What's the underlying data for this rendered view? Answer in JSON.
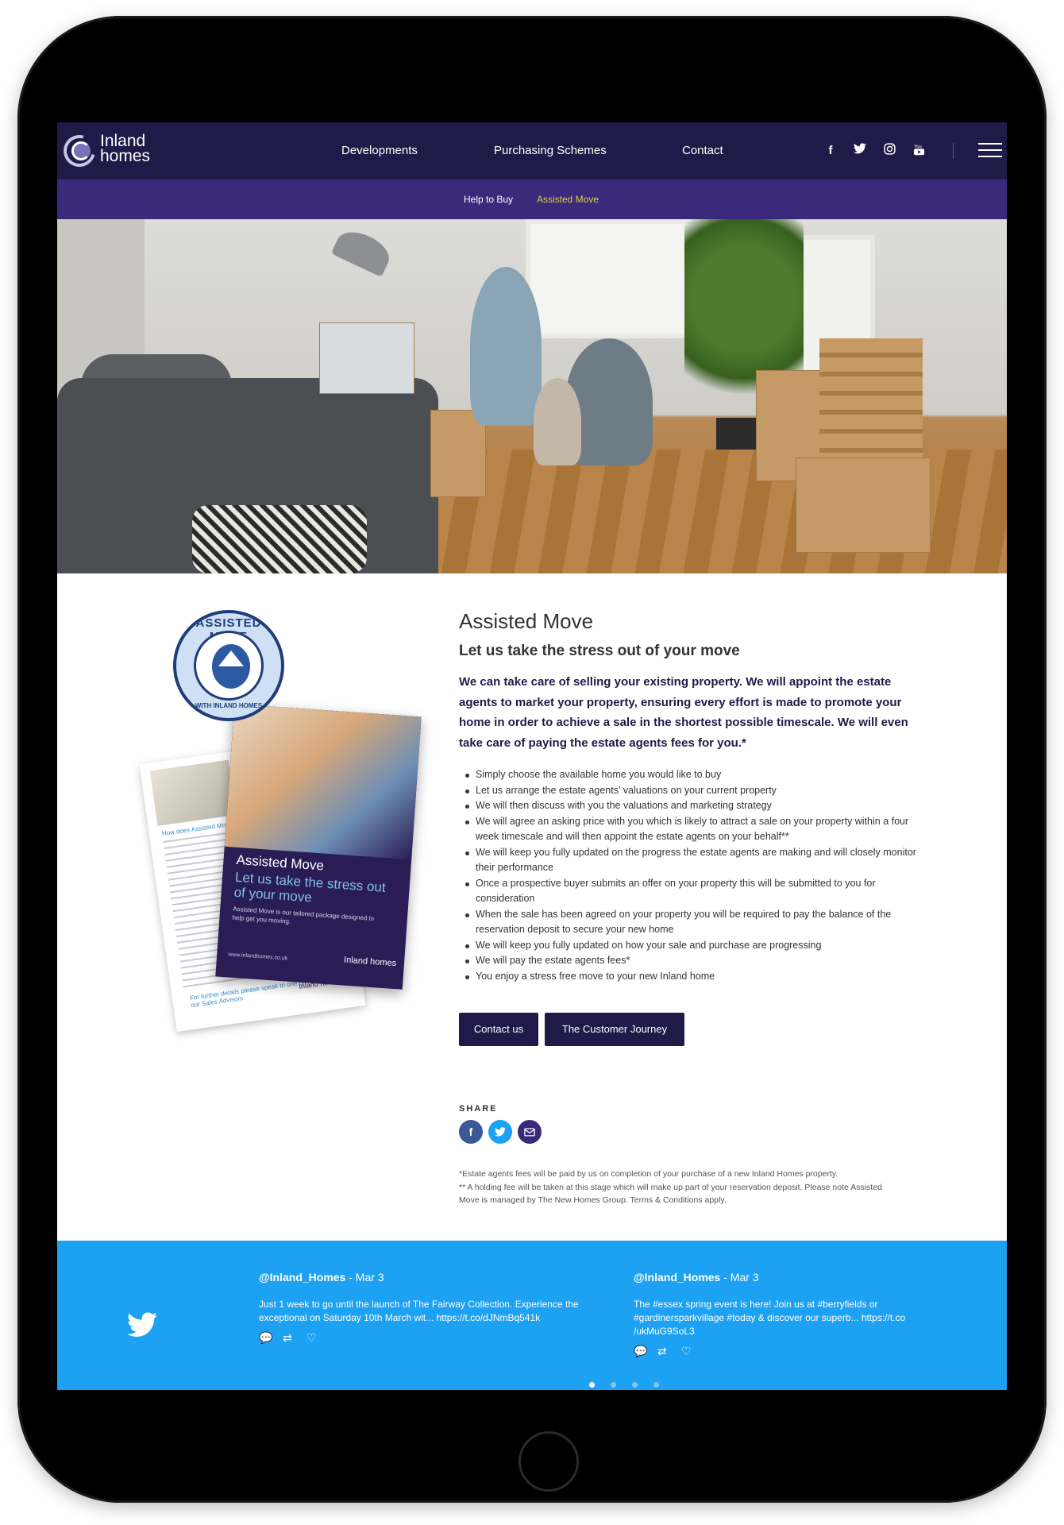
{
  "header": {
    "logo_line1": "Inland",
    "logo_line2": "homes",
    "nav": [
      "Developments",
      "Purchasing Schemes",
      "Contact"
    ],
    "social_icons": [
      "facebook-icon",
      "twitter-icon",
      "instagram-icon",
      "youtube-icon"
    ],
    "social_glyphs": [
      "f",
      "🐦",
      "◎",
      "▶"
    ]
  },
  "subnav": {
    "items": [
      "Help to Buy",
      "Assisted Move"
    ],
    "active_color": "#d8d13c"
  },
  "promo": {
    "badge_top": "ASSISTED MOVE",
    "badge_bottom": "WITH INLAND HOMES",
    "back_heading": "How does Assisted Move work?",
    "back_further": "For further details please speak to one of our Sales Advisors",
    "back_logo": "Inland homes",
    "front_title": "Assisted Move",
    "front_subtitle": "Let us take the stress out of your move",
    "front_desc": "Assisted Move is our tailored package designed to help get you moving.",
    "front_url": "www.inlandhomes.co.uk",
    "front_logo": "Inland homes"
  },
  "content": {
    "title": "Assisted Move",
    "subtitle": "Let us take the stress out of your move",
    "intro": "We can take care of selling your existing property. We will appoint the estate agents to market your property, ensuring every effort is made to promote your home in order to achieve a sale in the shortest possible timescale. We will even take care of paying the estate agents fees for you.*",
    "bullets": [
      "Simply choose the available home you would like to buy",
      "Let us arrange the estate agents’ valuations on your current property",
      "We will then discuss with you the valuations and marketing strategy",
      "We will agree an asking price with you which is likely to attract a sale on your property within a four week timescale and will then appoint the estate agents on your behalf**",
      "We will keep you fully updated on the progress the estate agents are making and will closely monitor their performance",
      "Once a prospective buyer submits an offer on your property this will be submitted to you for consideration",
      "When the sale has been agreed on your property you will be required to pay the balance of the reservation deposit to secure your new home",
      "We will keep you fully updated on how your sale and purchase are progressing",
      "We will pay the estate agents fees*",
      "You enjoy a stress free move to your new Inland home"
    ],
    "buttons": {
      "contact": "Contact us",
      "journey": "The Customer Journey"
    },
    "share_label": "SHARE",
    "footnotes": [
      "*Estate agents fees will be paid by us on completion of your purchase of a new Inland Homes property.",
      "** A holding fee will be taken at this stage which will make up part of your reservation deposit. Please note Assisted Move is managed by The New Homes Group. Terms & Conditions apply."
    ]
  },
  "twitter": {
    "tweets": [
      {
        "handle": "@Inland_Homes",
        "date": " - Mar 3",
        "body": "Just 1 week to go until the launch of The Fairway Collection. Experience the exceptional on Saturday 10th March wit... https://t.co/dJNmBq541k"
      },
      {
        "handle": "@Inland_Homes",
        "date": " - Mar 3",
        "body": "The #essex spring event is here! Join us at #berryfields or #gardinersparkvillage #today & discover our superb... https://t.co /ukMuG9SoL3"
      }
    ],
    "pager_count": 4,
    "pager_active": 0
  },
  "colors": {
    "header_bg": "#1f1a48",
    "subnav_bg": "#3b2a7c",
    "button_bg": "#1f1a48",
    "twitter_bg": "#1da1f2"
  }
}
